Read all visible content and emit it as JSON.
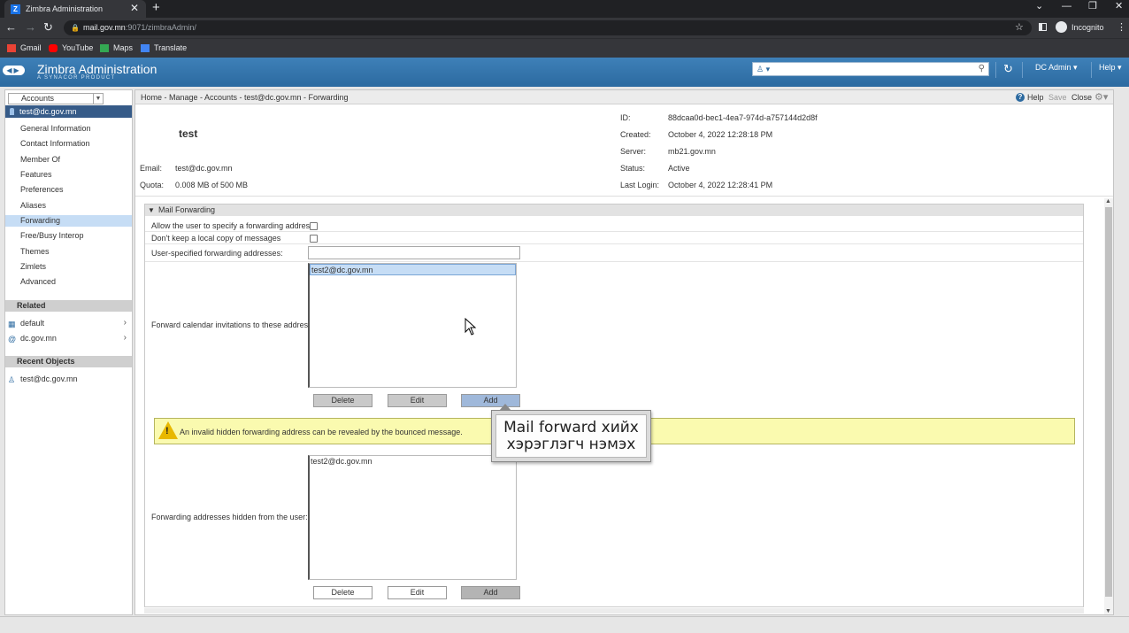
{
  "browser": {
    "tab_title": "Zimbra Administration",
    "tab_close": "✕",
    "new_tab": "+",
    "url_host": "mail.gov.mn",
    "url_path": ":9071/zimbraAdmin/",
    "incognito_label": "Incognito",
    "bookmarks": [
      {
        "label": "Gmail",
        "color": "#ea4335"
      },
      {
        "label": "YouTube",
        "color": "#ff0000"
      },
      {
        "label": "Maps",
        "color": "#34a853"
      },
      {
        "label": "Translate",
        "color": "#4285f4"
      }
    ]
  },
  "app": {
    "title": "Zimbra Administration",
    "subtitle": "A SYNACOR PRODUCT",
    "user_menu": "DC Admin",
    "help_menu": "Help"
  },
  "left": {
    "dropdown": "Accounts",
    "account": "test@dc.gov.mn",
    "nav": [
      {
        "label": "General Information",
        "selected": false
      },
      {
        "label": "Contact Information",
        "selected": false
      },
      {
        "label": "Member Of",
        "selected": false
      },
      {
        "label": "Features",
        "selected": false
      },
      {
        "label": "Preferences",
        "selected": false
      },
      {
        "label": "Aliases",
        "selected": false
      },
      {
        "label": "Forwarding",
        "selected": true
      },
      {
        "label": "Free/Busy Interop",
        "selected": false
      },
      {
        "label": "Themes",
        "selected": false
      },
      {
        "label": "Zimlets",
        "selected": false
      },
      {
        "label": "Advanced",
        "selected": false
      }
    ],
    "related_header": "Related",
    "related": [
      {
        "label": "default",
        "icon": "cos-icon"
      },
      {
        "label": "dc.gov.mn",
        "icon": "domain-icon"
      }
    ],
    "recent_header": "Recent Objects",
    "recent": [
      {
        "label": "test@dc.gov.mn",
        "icon": "account-icon"
      }
    ]
  },
  "toolbar": {
    "breadcrumb": "Home - Manage - Accounts - test@dc.gov.mn - Forwarding",
    "help": "Help",
    "save": "Save",
    "close": "Close"
  },
  "account_header": {
    "name": "test",
    "email_label": "Email:",
    "email": "test@dc.gov.mn",
    "quota_label": "Quota:",
    "quota": "0.008 MB of 500 MB",
    "id_label": "ID:",
    "id": "88dcaa0d-bec1-4ea7-974d-a757144d2d8f",
    "created_label": "Created:",
    "created": "October 4, 2022 12:28:18 PM",
    "server_label": "Server:",
    "server": "mb21.gov.mn",
    "status_label": "Status:",
    "status": "Active",
    "last_login_label": "Last Login:",
    "last_login": "October 4, 2022 12:28:41 PM"
  },
  "form": {
    "section_title": "Mail Forwarding",
    "allow_label": "Allow the user to specify a forwarding address",
    "allow_checked": false,
    "nokeep_label": "Don't keep a local copy of messages",
    "nokeep_checked": false,
    "user_fwd_label": "User-specified forwarding addresses:",
    "user_fwd_value": "",
    "calendar_label": "Forward calendar invitations to these addresses:",
    "calendar_list": [
      "test2@dc.gov.mn"
    ],
    "hidden_label": "Forwarding addresses hidden from the user:",
    "hidden_list": [
      "test2@dc.gov.mn"
    ],
    "delete_label": "Delete",
    "edit_label": "Edit",
    "add_label": "Add",
    "add_label_partial": "Add",
    "warning": "An invalid hidden forwarding address can be revealed by the bounced message."
  },
  "tooltip": {
    "line1": "Mail forward хийх",
    "line2": "хэрэглэгч нэмэх"
  }
}
